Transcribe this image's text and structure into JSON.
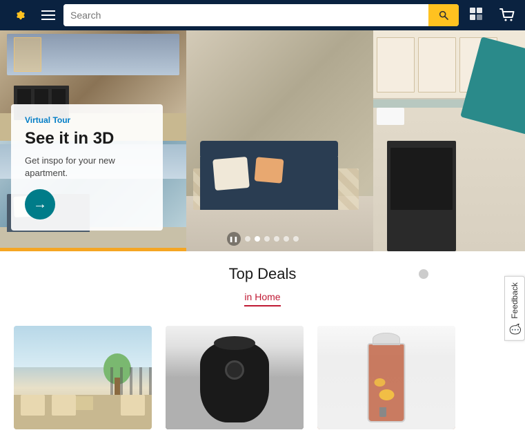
{
  "header": {
    "logo_alt": "Walmart",
    "search_placeholder": "Search",
    "search_button_label": "Search",
    "menu_label": "Menu",
    "account_icon": "account-icon",
    "cart_icon": "cart-icon"
  },
  "hero": {
    "badge": "Virtual Tour",
    "title": "See it in 3D",
    "subtitle": "Get inspo for your new apartment.",
    "cta_arrow": "→",
    "carousel": {
      "pause_label": "❚❚",
      "dots": [
        {
          "id": 1,
          "active": false
        },
        {
          "id": 2,
          "active": true
        },
        {
          "id": 3,
          "active": false
        },
        {
          "id": 4,
          "active": false
        },
        {
          "id": 5,
          "active": false
        },
        {
          "id": 6,
          "active": false
        }
      ]
    }
  },
  "top_deals": {
    "title": "Top Deals",
    "tab_label": "in Home"
  },
  "products": [
    {
      "id": 1,
      "type": "patio-furniture",
      "alt": "Patio furniture set"
    },
    {
      "id": 2,
      "type": "air-fryer",
      "alt": "Black air fryer"
    },
    {
      "id": 3,
      "type": "drink-dispenser",
      "alt": "Drink dispenser with citrus"
    }
  ],
  "feedback": {
    "label": "Feedback",
    "icon": "chat-icon"
  }
}
